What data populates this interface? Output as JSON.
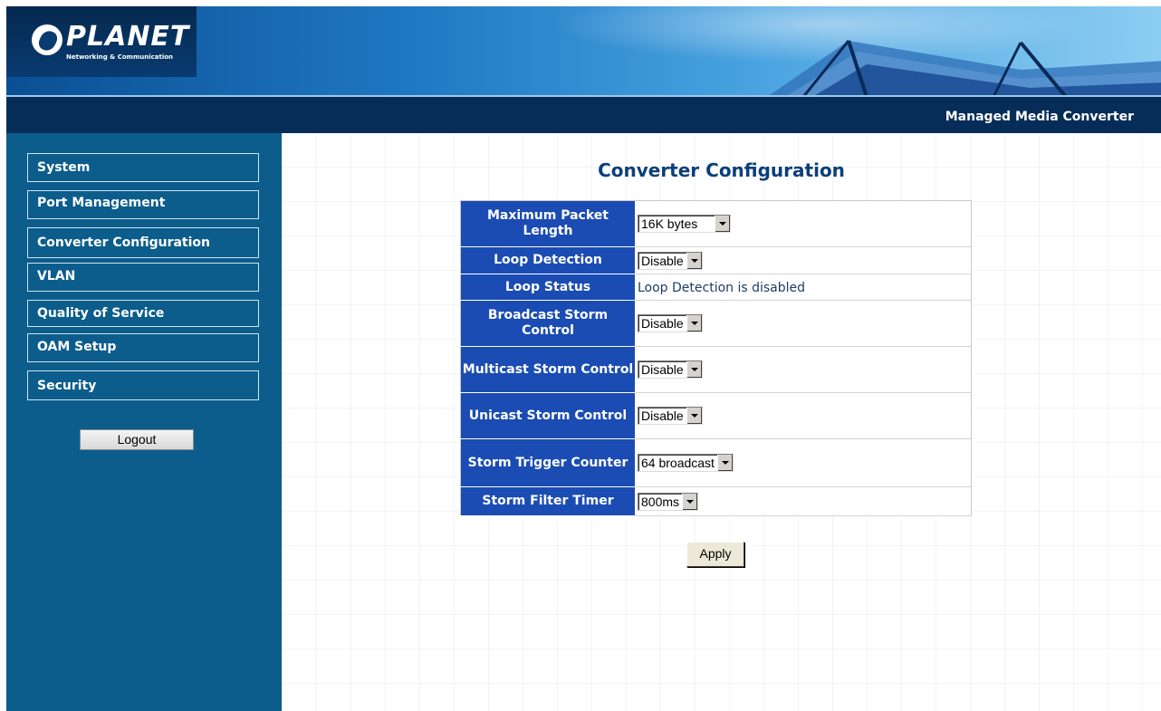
{
  "header": {
    "logo_text": "PLANET",
    "logo_subtitle": "Networking & Communication",
    "product_title": "Managed Media Converter"
  },
  "sidebar": {
    "items": [
      {
        "label": "System"
      },
      {
        "label": "Port Management"
      },
      {
        "label": "Converter Configuration"
      },
      {
        "label": "VLAN"
      },
      {
        "label": "Quality of Service"
      },
      {
        "label": "OAM Setup"
      },
      {
        "label": "Security"
      }
    ],
    "logout_label": "Logout"
  },
  "main": {
    "title": "Converter Configuration",
    "rows": [
      {
        "label": "Maximum Packet Length",
        "value": "16K bytes"
      },
      {
        "label": "Loop Detection",
        "value": "Disable"
      },
      {
        "label": "Loop Status",
        "value": "Loop Detection is disabled"
      },
      {
        "label": "Broadcast Storm Control",
        "value": "Disable"
      },
      {
        "label": "Multicast Storm Control",
        "value": "Disable"
      },
      {
        "label": "Unicast Storm Control",
        "value": "Disable"
      },
      {
        "label": "Storm Trigger Counter",
        "value": "64 broadcast"
      },
      {
        "label": "Storm Filter Timer",
        "value": "800ms"
      }
    ],
    "apply_label": "Apply"
  },
  "colors": {
    "header_dark": "#062d57",
    "sidebar_bg": "#0c5d8c",
    "label_cell_bg": "#1b4cb3",
    "title_text": "#0b3f7a"
  }
}
